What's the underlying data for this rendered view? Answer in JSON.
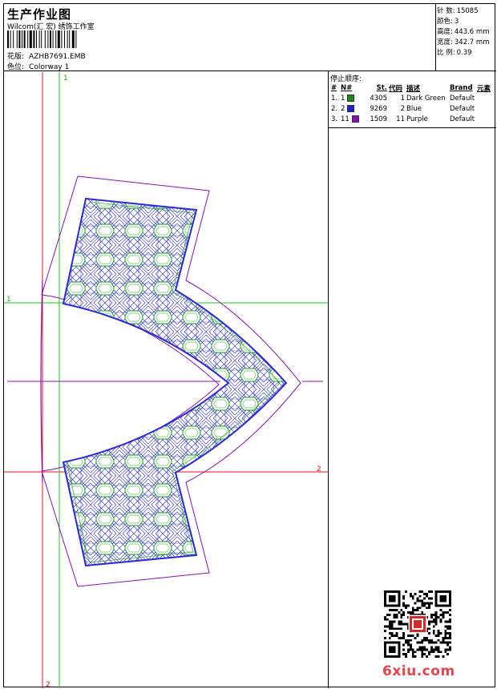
{
  "header": {
    "title": "生产作业图",
    "company": "Wilcom(汇 宏) 绣饰工作室",
    "design_label": "花版:",
    "design_value": "AZHB7691.EMB",
    "colorway_label": "色位:",
    "colorway_value": "Colorway 1"
  },
  "stats": [
    {
      "label": "针 数:",
      "value": "15085"
    },
    {
      "label": "颜色:",
      "value": "3"
    },
    {
      "label": "高度:",
      "value": "443.6 mm"
    },
    {
      "label": "宽度:",
      "value": "342.7 mm"
    },
    {
      "label": "比 例:",
      "value": "0.39"
    }
  ],
  "sequence": {
    "title": "停止顺序:",
    "headers": [
      "#",
      "N#",
      "St.",
      "代码",
      "描述",
      "Brand",
      "元素"
    ],
    "rows": [
      {
        "idx": "1.",
        "n": "1",
        "st": "4305",
        "code": "1",
        "desc": "Dark Green",
        "brand": "Default",
        "color": "#1a8a1a"
      },
      {
        "idx": "2.",
        "n": "2",
        "st": "9269",
        "code": "2",
        "desc": "Blue",
        "brand": "Default",
        "color": "#1f1fd6"
      },
      {
        "idx": "3.",
        "n": "11",
        "st": "1509",
        "code": "11",
        "desc": "Purple",
        "brand": "Default",
        "color": "#8a10b8"
      }
    ]
  },
  "guides": {
    "top_label_1": "1",
    "left_label_1": "1",
    "right_label_2": "2",
    "bottom_label_2": "2"
  },
  "watermark": "6xiu.com"
}
